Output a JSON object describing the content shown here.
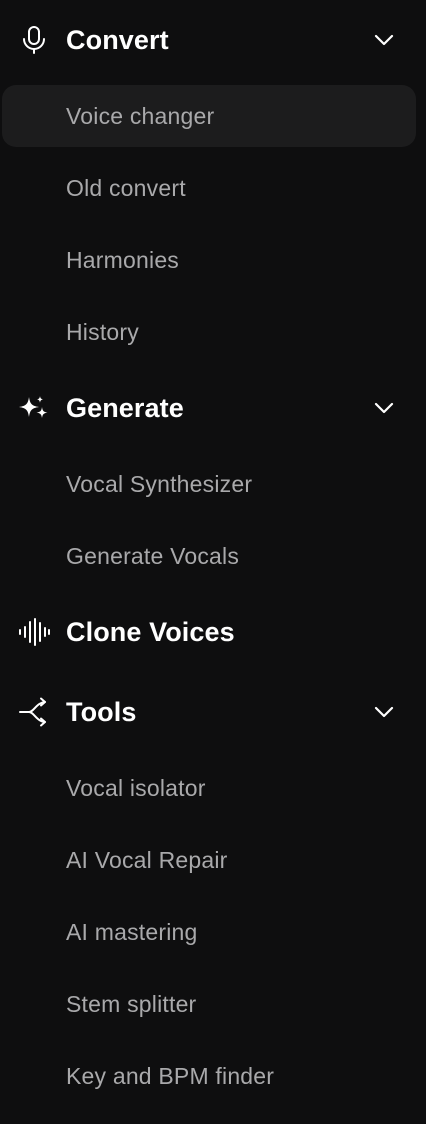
{
  "sections": [
    {
      "label": "Convert",
      "icon": "microphone-icon",
      "expanded": true,
      "items": [
        {
          "label": "Voice changer",
          "active": true
        },
        {
          "label": "Old convert"
        },
        {
          "label": "Harmonies"
        },
        {
          "label": "History"
        }
      ]
    },
    {
      "label": "Generate",
      "icon": "sparkles-icon",
      "expanded": true,
      "items": [
        {
          "label": "Vocal Synthesizer"
        },
        {
          "label": "Generate Vocals"
        }
      ]
    },
    {
      "label": "Clone Voices",
      "icon": "waveform-icon"
    },
    {
      "label": "Tools",
      "icon": "branch-arrow-icon",
      "expanded": true,
      "items": [
        {
          "label": "Vocal isolator"
        },
        {
          "label": "AI Vocal Repair"
        },
        {
          "label": "AI mastering"
        },
        {
          "label": "Stem splitter"
        },
        {
          "label": "Key and BPM finder"
        }
      ]
    }
  ],
  "colors": {
    "background": "#0e0e0f",
    "active_item_bg": "#1c1c1d",
    "header_text": "#ffffff",
    "item_text": "#a9a9ab"
  }
}
